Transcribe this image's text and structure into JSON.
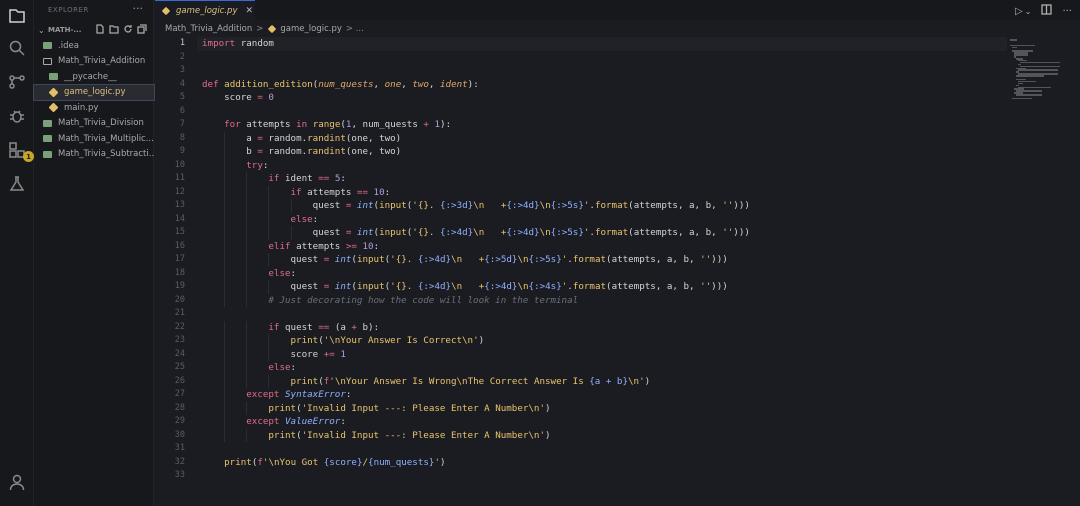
{
  "sidebar": {
    "title": "EXPLORER",
    "more": "···",
    "project": "MATH-...",
    "items": [
      {
        "label": ".idea",
        "type": "folder",
        "indent": 0
      },
      {
        "label": "Math_Trivia_Addition",
        "type": "folder-open",
        "indent": 0
      },
      {
        "label": "__pycache__",
        "type": "folder",
        "indent": 1
      },
      {
        "label": "game_logic.py",
        "type": "py",
        "indent": 1,
        "selected": true
      },
      {
        "label": "main.py",
        "type": "py",
        "indent": 1
      },
      {
        "label": "Math_Trivia_Division",
        "type": "folder",
        "indent": 0
      },
      {
        "label": "Math_Trivia_Multiplic...",
        "type": "folder",
        "indent": 0
      },
      {
        "label": "Math_Trivia_Subtracti...",
        "type": "folder",
        "indent": 0
      }
    ]
  },
  "activity": {
    "badge": "1"
  },
  "tabs": [
    {
      "label": "game_logic.py",
      "close": "✕",
      "active": true
    }
  ],
  "toolbar": {
    "run": "▷",
    "run_dropdown": "⌄",
    "more": "···"
  },
  "breadcrumb": {
    "folder": "Math_Trivia_Addition",
    "sep": ">",
    "file": "game_logic.py",
    "tail": "> ..."
  },
  "editor": {
    "active_line": 1,
    "line_numbers": [
      "1",
      "2",
      "3",
      "4",
      "5",
      "6",
      "7",
      "8",
      "9",
      "10",
      "11",
      "12",
      "13",
      "14",
      "15",
      "16",
      "17",
      "18",
      "19",
      "20",
      "21",
      "22",
      "23",
      "24",
      "25",
      "26",
      "27",
      "28",
      "29",
      "30",
      "31",
      "32",
      "33"
    ],
    "lines": [
      [
        {
          "t": "import",
          "c": "kw"
        },
        {
          "t": " random"
        }
      ],
      [],
      [],
      [
        {
          "t": "def",
          "c": "kw"
        },
        {
          "t": " "
        },
        {
          "t": "addition_edition",
          "c": "fn"
        },
        {
          "t": "("
        },
        {
          "t": "num_quests",
          "c": "pm"
        },
        {
          "t": ", "
        },
        {
          "t": "one",
          "c": "pm"
        },
        {
          "t": ", "
        },
        {
          "t": "two",
          "c": "pm"
        },
        {
          "t": ", "
        },
        {
          "t": "ident",
          "c": "pm"
        },
        {
          "t": "):"
        }
      ],
      [
        {
          "t": "    score "
        },
        {
          "t": "=",
          "c": "op"
        },
        {
          "t": " "
        },
        {
          "t": "0",
          "c": "num"
        }
      ],
      [],
      [
        {
          "t": "    "
        },
        {
          "t": "for",
          "c": "kw"
        },
        {
          "t": " attempts "
        },
        {
          "t": "in",
          "c": "kw"
        },
        {
          "t": " "
        },
        {
          "t": "range",
          "c": "fn"
        },
        {
          "t": "("
        },
        {
          "t": "1",
          "c": "num"
        },
        {
          "t": ", num_quests "
        },
        {
          "t": "+",
          "c": "op"
        },
        {
          "t": " "
        },
        {
          "t": "1",
          "c": "num"
        },
        {
          "t": "):"
        }
      ],
      [
        {
          "t": "        a "
        },
        {
          "t": "=",
          "c": "op"
        },
        {
          "t": " random."
        },
        {
          "t": "randint",
          "c": "fn"
        },
        {
          "t": "(one, two)"
        }
      ],
      [
        {
          "t": "        b "
        },
        {
          "t": "=",
          "c": "op"
        },
        {
          "t": " random."
        },
        {
          "t": "randint",
          "c": "fn"
        },
        {
          "t": "(one, two)"
        }
      ],
      [
        {
          "t": "        "
        },
        {
          "t": "try",
          "c": "kw"
        },
        {
          "t": ":"
        }
      ],
      [
        {
          "t": "            "
        },
        {
          "t": "if",
          "c": "kw"
        },
        {
          "t": " ident "
        },
        {
          "t": "==",
          "c": "op"
        },
        {
          "t": " "
        },
        {
          "t": "5",
          "c": "num"
        },
        {
          "t": ":"
        }
      ],
      [
        {
          "t": "                "
        },
        {
          "t": "if",
          "c": "kw"
        },
        {
          "t": " attempts "
        },
        {
          "t": "==",
          "c": "op"
        },
        {
          "t": " "
        },
        {
          "t": "10",
          "c": "num"
        },
        {
          "t": ":"
        }
      ],
      [
        {
          "t": "                    quest "
        },
        {
          "t": "=",
          "c": "op"
        },
        {
          "t": " "
        },
        {
          "t": "int",
          "c": "bi"
        },
        {
          "t": "("
        },
        {
          "t": "input",
          "c": "fn"
        },
        {
          "t": "("
        },
        {
          "t": "'{}. ",
          "c": "str"
        },
        {
          "t": "{:>3d}",
          "c": "fmt"
        },
        {
          "t": "\\n   +",
          "c": "str"
        },
        {
          "t": "{:>4d}",
          "c": "fmt"
        },
        {
          "t": "\\n",
          "c": "str"
        },
        {
          "t": "{:>5s}",
          "c": "fmt"
        },
        {
          "t": "'",
          "c": "str"
        },
        {
          "t": "."
        },
        {
          "t": "format",
          "c": "fn"
        },
        {
          "t": "(attempts, a, b, "
        },
        {
          "t": "''",
          "c": "str"
        },
        {
          "t": ")))"
        }
      ],
      [
        {
          "t": "                "
        },
        {
          "t": "else",
          "c": "kw"
        },
        {
          "t": ":"
        }
      ],
      [
        {
          "t": "                    quest "
        },
        {
          "t": "=",
          "c": "op"
        },
        {
          "t": " "
        },
        {
          "t": "int",
          "c": "bi"
        },
        {
          "t": "("
        },
        {
          "t": "input",
          "c": "fn"
        },
        {
          "t": "("
        },
        {
          "t": "'{}. ",
          "c": "str"
        },
        {
          "t": "{:>4d}",
          "c": "fmt"
        },
        {
          "t": "\\n   +",
          "c": "str"
        },
        {
          "t": "{:>4d}",
          "c": "fmt"
        },
        {
          "t": "\\n",
          "c": "str"
        },
        {
          "t": "{:>5s}",
          "c": "fmt"
        },
        {
          "t": "'",
          "c": "str"
        },
        {
          "t": "."
        },
        {
          "t": "format",
          "c": "fn"
        },
        {
          "t": "(attempts, a, b, "
        },
        {
          "t": "''",
          "c": "str"
        },
        {
          "t": ")))"
        }
      ],
      [
        {
          "t": "            "
        },
        {
          "t": "elif",
          "c": "kw"
        },
        {
          "t": " attempts "
        },
        {
          "t": ">=",
          "c": "op"
        },
        {
          "t": " "
        },
        {
          "t": "10",
          "c": "num"
        },
        {
          "t": ":"
        }
      ],
      [
        {
          "t": "                quest "
        },
        {
          "t": "=",
          "c": "op"
        },
        {
          "t": " "
        },
        {
          "t": "int",
          "c": "bi"
        },
        {
          "t": "("
        },
        {
          "t": "input",
          "c": "fn"
        },
        {
          "t": "("
        },
        {
          "t": "'{}. ",
          "c": "str"
        },
        {
          "t": "{:>4d}",
          "c": "fmt"
        },
        {
          "t": "\\n   +",
          "c": "str"
        },
        {
          "t": "{:>5d}",
          "c": "fmt"
        },
        {
          "t": "\\n",
          "c": "str"
        },
        {
          "t": "{:>5s}",
          "c": "fmt"
        },
        {
          "t": "'",
          "c": "str"
        },
        {
          "t": "."
        },
        {
          "t": "format",
          "c": "fn"
        },
        {
          "t": "(attempts, a, b, "
        },
        {
          "t": "''",
          "c": "str"
        },
        {
          "t": ")))"
        }
      ],
      [
        {
          "t": "            "
        },
        {
          "t": "else",
          "c": "kw"
        },
        {
          "t": ":"
        }
      ],
      [
        {
          "t": "                quest "
        },
        {
          "t": "=",
          "c": "op"
        },
        {
          "t": " "
        },
        {
          "t": "int",
          "c": "bi"
        },
        {
          "t": "("
        },
        {
          "t": "input",
          "c": "fn"
        },
        {
          "t": "("
        },
        {
          "t": "'{}. ",
          "c": "str"
        },
        {
          "t": "{:>4d}",
          "c": "fmt"
        },
        {
          "t": "\\n   +",
          "c": "str"
        },
        {
          "t": "{:>4d}",
          "c": "fmt"
        },
        {
          "t": "\\n",
          "c": "str"
        },
        {
          "t": "{:>4s}",
          "c": "fmt"
        },
        {
          "t": "'",
          "c": "str"
        },
        {
          "t": "."
        },
        {
          "t": "format",
          "c": "fn"
        },
        {
          "t": "(attempts, a, b, "
        },
        {
          "t": "''",
          "c": "str"
        },
        {
          "t": ")))"
        }
      ],
      [
        {
          "t": "            "
        },
        {
          "t": "# Just decorating how the code will look in the terminal",
          "c": "cm"
        }
      ],
      [],
      [
        {
          "t": "            "
        },
        {
          "t": "if",
          "c": "kw"
        },
        {
          "t": " quest "
        },
        {
          "t": "==",
          "c": "op"
        },
        {
          "t": " (a "
        },
        {
          "t": "+",
          "c": "op"
        },
        {
          "t": " b):"
        }
      ],
      [
        {
          "t": "                "
        },
        {
          "t": "print",
          "c": "fn"
        },
        {
          "t": "("
        },
        {
          "t": "'\\nYour Answer Is Correct\\n'",
          "c": "str"
        },
        {
          "t": ")"
        }
      ],
      [
        {
          "t": "                score "
        },
        {
          "t": "+=",
          "c": "op"
        },
        {
          "t": " "
        },
        {
          "t": "1",
          "c": "num"
        }
      ],
      [
        {
          "t": "            "
        },
        {
          "t": "else",
          "c": "kw"
        },
        {
          "t": ":"
        }
      ],
      [
        {
          "t": "                "
        },
        {
          "t": "print",
          "c": "fn"
        },
        {
          "t": "("
        },
        {
          "t": "f",
          "c": "kw"
        },
        {
          "t": "'\\nYour Answer Is Wrong\\nThe Correct Answer Is ",
          "c": "str"
        },
        {
          "t": "{a + b}",
          "c": "fmt"
        },
        {
          "t": "\\n'",
          "c": "str"
        },
        {
          "t": ")"
        }
      ],
      [
        {
          "t": "        "
        },
        {
          "t": "except",
          "c": "kw"
        },
        {
          "t": " "
        },
        {
          "t": "SyntaxError",
          "c": "bi"
        },
        {
          "t": ":"
        }
      ],
      [
        {
          "t": "            "
        },
        {
          "t": "print",
          "c": "fn"
        },
        {
          "t": "("
        },
        {
          "t": "'Invalid Input ---: Please Enter A Number\\n'",
          "c": "str"
        },
        {
          "t": ")"
        }
      ],
      [
        {
          "t": "        "
        },
        {
          "t": "except",
          "c": "kw"
        },
        {
          "t": " "
        },
        {
          "t": "ValueError",
          "c": "bi"
        },
        {
          "t": ":"
        }
      ],
      [
        {
          "t": "            "
        },
        {
          "t": "print",
          "c": "fn"
        },
        {
          "t": "("
        },
        {
          "t": "'Invalid Input ---: Please Enter A Number\\n'",
          "c": "str"
        },
        {
          "t": ")"
        }
      ],
      [],
      [
        {
          "t": "    "
        },
        {
          "t": "print",
          "c": "fn"
        },
        {
          "t": "("
        },
        {
          "t": "f",
          "c": "kw"
        },
        {
          "t": "'\\nYou Got ",
          "c": "str"
        },
        {
          "t": "{score}",
          "c": "fmt"
        },
        {
          "t": "/",
          "c": "str"
        },
        {
          "t": "{num_quests}",
          "c": "fmt"
        },
        {
          "t": "'",
          "c": "str"
        },
        {
          "t": ")"
        }
      ],
      []
    ]
  },
  "colors": {
    "accent": "#3b6ad6",
    "keyword": "#e06c8a",
    "function": "#e7c36d",
    "badge": "#c8a52a"
  }
}
